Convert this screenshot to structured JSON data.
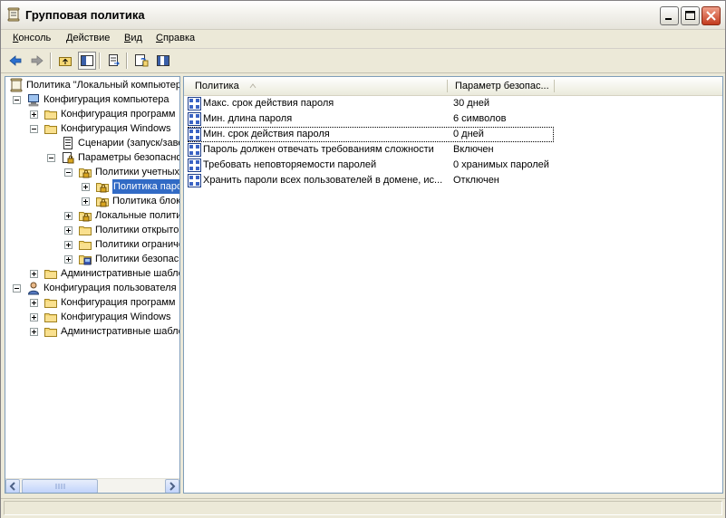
{
  "window": {
    "title": "Групповая политика"
  },
  "menu": [
    {
      "hot": "К",
      "rest": "онсоль"
    },
    {
      "hot": "Д",
      "rest": "ействие"
    },
    {
      "hot": "В",
      "rest": "ид"
    },
    {
      "hot": "С",
      "rest": "правка"
    }
  ],
  "tree": [
    {
      "label": "Политика \"Локальный компьютер\"",
      "depth": 0,
      "toggle": "none",
      "icon": "policy-scroll-icon",
      "selected": false
    },
    {
      "label": "Конфигурация компьютера",
      "depth": 1,
      "toggle": "minus",
      "icon": "computer-icon",
      "selected": false
    },
    {
      "label": "Конфигурация программ",
      "depth": 2,
      "toggle": "plus",
      "icon": "folder-icon",
      "selected": false
    },
    {
      "label": "Конфигурация Windows",
      "depth": 2,
      "toggle": "minus",
      "icon": "folder-icon",
      "selected": false
    },
    {
      "label": "Сценарии (запуск/завершение)",
      "depth": 3,
      "toggle": "none",
      "icon": "scripts-icon",
      "selected": false
    },
    {
      "label": "Параметры безопасности",
      "depth": 3,
      "toggle": "minus",
      "icon": "security-settings-icon",
      "selected": false
    },
    {
      "label": "Политики учетных записей",
      "depth": 4,
      "toggle": "minus",
      "icon": "locked-folder-icon",
      "selected": false
    },
    {
      "label": "Политика паролей",
      "depth": 5,
      "toggle": "plus",
      "icon": "locked-folder-icon",
      "selected": true
    },
    {
      "label": "Политика блокировки учетной записи",
      "depth": 5,
      "toggle": "plus",
      "icon": "locked-folder-icon",
      "selected": false
    },
    {
      "label": "Локальные политики",
      "depth": 4,
      "toggle": "plus",
      "icon": "locked-folder-icon",
      "selected": false
    },
    {
      "label": "Политики открытого ключа",
      "depth": 4,
      "toggle": "plus",
      "icon": "folder-icon",
      "selected": false
    },
    {
      "label": "Политики ограниченного использования программ",
      "depth": 4,
      "toggle": "plus",
      "icon": "folder-icon",
      "selected": false
    },
    {
      "label": "Политики безопасности IP",
      "depth": 4,
      "toggle": "plus",
      "icon": "ip-security-icon",
      "selected": false
    },
    {
      "label": "Административные шаблоны",
      "depth": 2,
      "toggle": "plus",
      "icon": "folder-icon",
      "selected": false
    },
    {
      "label": "Конфигурация пользователя",
      "depth": 1,
      "toggle": "minus",
      "icon": "user-icon",
      "selected": false
    },
    {
      "label": "Конфигурация программ",
      "depth": 2,
      "toggle": "plus",
      "icon": "folder-icon",
      "selected": false
    },
    {
      "label": "Конфигурация Windows",
      "depth": 2,
      "toggle": "plus",
      "icon": "folder-icon",
      "selected": false
    },
    {
      "label": "Административные шаблоны",
      "depth": 2,
      "toggle": "plus",
      "icon": "folder-icon",
      "selected": false
    }
  ],
  "list": {
    "columns": [
      "Политика",
      "Параметр безопас..."
    ],
    "rows": [
      {
        "name": "Макс. срок действия пароля",
        "value": "30 дней",
        "focused": false
      },
      {
        "name": "Мин. длина пароля",
        "value": "6 символов",
        "focused": false
      },
      {
        "name": "Мин. срок действия пароля",
        "value": "0 дней",
        "focused": true
      },
      {
        "name": "Пароль должен отвечать требованиям сложности",
        "value": "Включен",
        "focused": false
      },
      {
        "name": "Требовать неповторяемости паролей",
        "value": "0 хранимых паролей",
        "focused": false
      },
      {
        "name": "Хранить пароли всех пользователей в домене, ис...",
        "value": "Отключен",
        "focused": false
      }
    ]
  }
}
